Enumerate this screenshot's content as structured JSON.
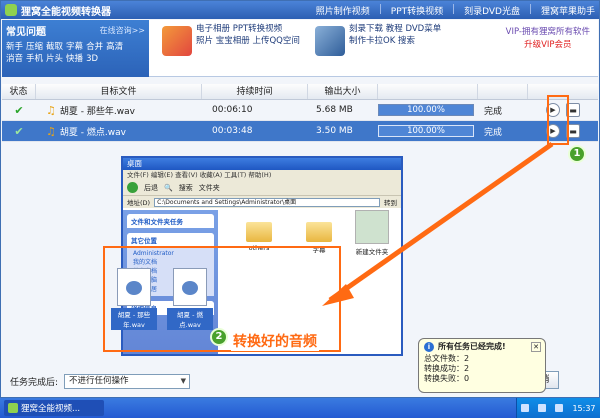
{
  "app": {
    "title": "狸窝全能视频转换器",
    "links": [
      "照片制作视频",
      "PPT转换视频",
      "刻录DVD光盘",
      "狸窝苹果助手"
    ]
  },
  "banner": {
    "faq_title": "常见问题",
    "faq_more": "在线咨询>>",
    "faq_links": [
      "新手",
      "压缩",
      "截取",
      "字幕",
      "合并",
      "高清",
      "消音",
      "手机",
      "片头",
      "快播",
      "3D"
    ],
    "promo1": [
      "电子相册",
      "PPT转换视频",
      "照片",
      "宝宝相册",
      "上传QQ空间"
    ],
    "promo2": [
      "刻录下载",
      "教程",
      "DVD菜单",
      "制作卡拉OK",
      "搜索"
    ],
    "vip_line1": "VIP-拥有狸窝所有软件",
    "vip_line2": "升级VIP会员"
  },
  "table": {
    "headers": [
      "状态",
      "目标文件",
      "持续时间",
      "输出大小",
      "",
      "",
      ""
    ],
    "rows": [
      {
        "file": "胡夏 - 那些年.wav",
        "duration": "00:06:10",
        "size": "5.68 MB",
        "progress": "100.00%",
        "status": "完成"
      },
      {
        "file": "胡夏 - 燃点.wav",
        "duration": "00:03:48",
        "size": "3.50 MB",
        "progress": "100.00%",
        "status": "完成"
      }
    ]
  },
  "explorer": {
    "title": "桌面",
    "menu": "文件(F) 编辑(E) 查看(V) 收藏(A) 工具(T) 帮助(H)",
    "back_label": "后退",
    "search_label": "搜索",
    "folders_label": "文件夹",
    "address_label": "地址(D)",
    "address": "C:\\Documents and Settings\\Administrator\\桌面",
    "go_label": "转到",
    "panel1": "文件和文件夹任务",
    "panel2": "其它位置",
    "panel2_items": [
      "Administrator",
      "我的文档",
      "共享文档",
      "我的电脑",
      "网上邻居"
    ],
    "panel3": "详细信息",
    "items": [
      "others",
      "字幕",
      "新建文件夹"
    ],
    "sound_files": [
      "胡夏 - 那些年.wav",
      "胡夏 - 燃点.wav"
    ],
    "caption": "转换好的音频"
  },
  "badges": [
    "1",
    "2"
  ],
  "footer": {
    "after_label": "任务完成后:",
    "after_value": "不进行任何操作",
    "stop_label": "消"
  },
  "balloon": {
    "title": "所有任务已经完成!",
    "lines": [
      "总文件数：2",
      "转换成功：2",
      "转换失败：0"
    ]
  },
  "taskbar": {
    "app_label": "狸窝全能视频...",
    "clock": "15:37"
  },
  "colors": {
    "highlight": "#ff6a13",
    "selected_row": "#3f77c9",
    "badge": "#49a12c"
  }
}
